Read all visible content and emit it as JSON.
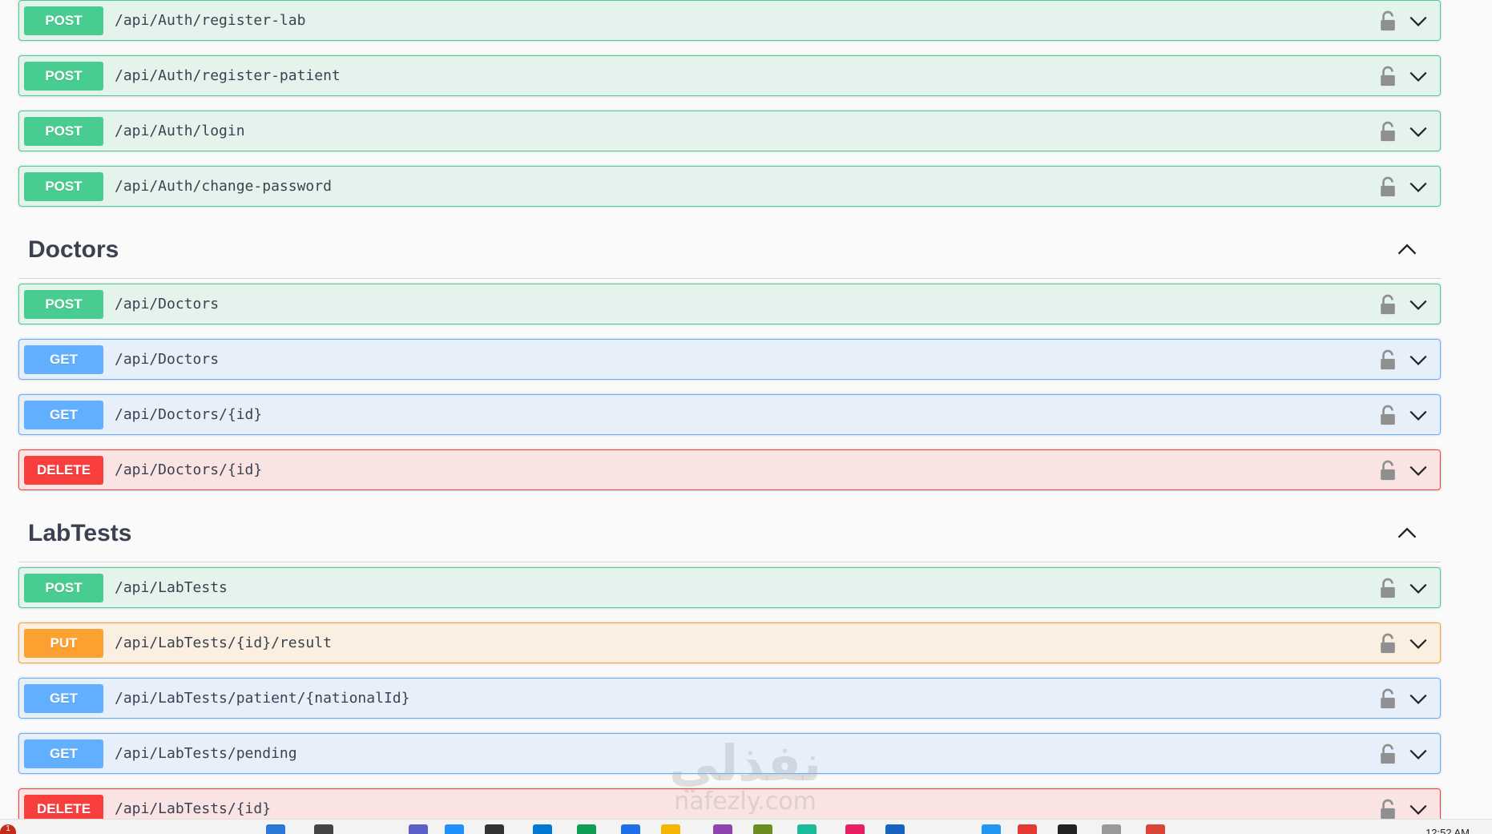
{
  "sections": [
    {
      "title": "",
      "operations": [
        {
          "method": "POST",
          "path": "/api/Auth/register-lab"
        },
        {
          "method": "POST",
          "path": "/api/Auth/register-patient"
        },
        {
          "method": "POST",
          "path": "/api/Auth/login"
        },
        {
          "method": "POST",
          "path": "/api/Auth/change-password"
        }
      ]
    },
    {
      "title": "Doctors",
      "operations": [
        {
          "method": "POST",
          "path": "/api/Doctors"
        },
        {
          "method": "GET",
          "path": "/api/Doctors"
        },
        {
          "method": "GET",
          "path": "/api/Doctors/{id}"
        },
        {
          "method": "DELETE",
          "path": "/api/Doctors/{id}"
        }
      ]
    },
    {
      "title": "LabTests",
      "operations": [
        {
          "method": "POST",
          "path": "/api/LabTests"
        },
        {
          "method": "PUT",
          "path": "/api/LabTests/{id}/result"
        },
        {
          "method": "GET",
          "path": "/api/LabTests/patient/{nationalId}"
        },
        {
          "method": "GET",
          "path": "/api/LabTests/pending"
        },
        {
          "method": "DELETE",
          "path": "/api/LabTests/{id}"
        }
      ]
    }
  ],
  "method_colors": {
    "POST": "#49cc90",
    "GET": "#61affe",
    "DELETE": "#f93e3e",
    "PUT": "#fca130"
  },
  "icons": {
    "lock": "lock-icon",
    "expand": "chevron-down-icon",
    "collapse": "chevron-up-icon"
  },
  "watermark": {
    "arabic": "نفذلي",
    "latin": "nafezly.com"
  },
  "taskbar": {
    "notification_count": "1",
    "clock": "12:52 AM"
  }
}
